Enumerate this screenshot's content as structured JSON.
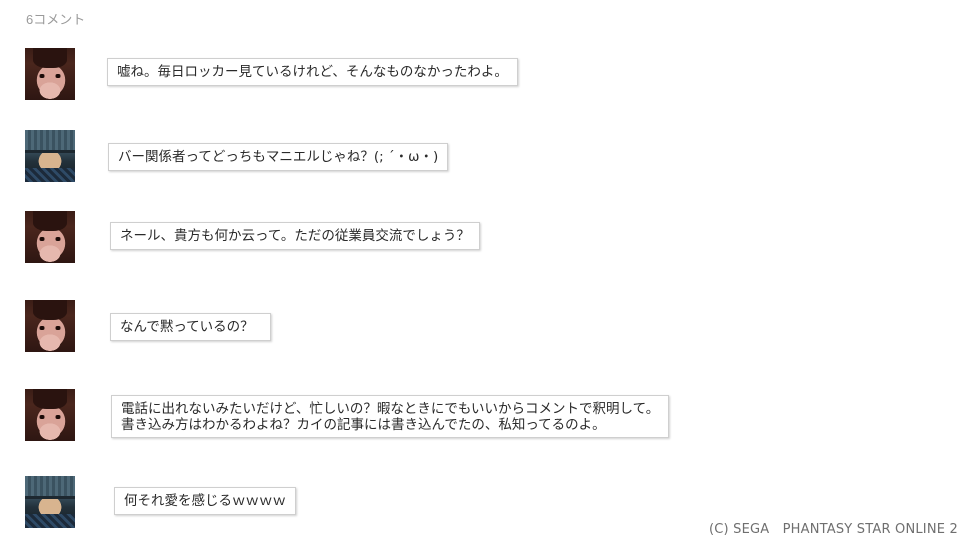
{
  "comment_count": "6コメント",
  "comments": [
    {
      "avatar": "female-character-avatar",
      "text": "嘘ね。毎日ロッカー見ているけれど、そんなものなかったわよ。"
    },
    {
      "avatar": "male-character-avatar",
      "text": "バー関係者ってどっちもマニエルじゃね？(; ´・ω・)"
    },
    {
      "avatar": "female-character-avatar",
      "text": "ネール、貴方も何か云って。ただの従業員交流でしょう？"
    },
    {
      "avatar": "female-character-avatar",
      "text": "なんで黙っているの？"
    },
    {
      "avatar": "female-character-avatar",
      "text_line1": "電話に出れないみたいだけど、忙しいの？暇なときにでもいいからコメントで釈明して。",
      "text_line2": "書き込み方はわかるわよね？カイの記事には書き込んでたの、私知ってるのよ。"
    },
    {
      "avatar": "male-character-avatar",
      "text": "何それ愛を感じるｗｗｗｗ"
    }
  ],
  "copyright": "(C) SEGA　PHANTASY STAR ONLINE 2"
}
